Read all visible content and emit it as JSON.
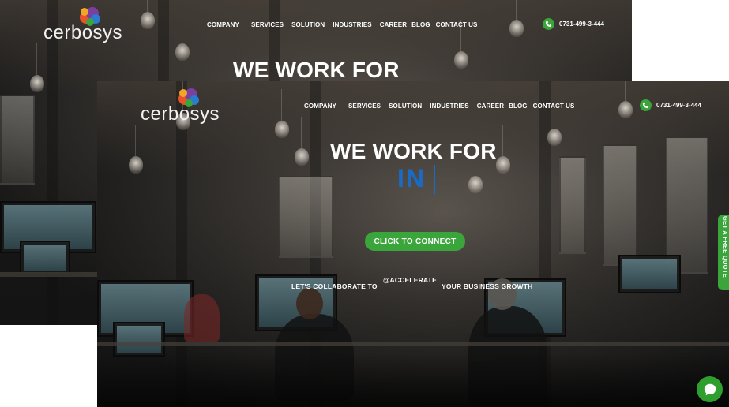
{
  "brand": {
    "name": "cerbosys"
  },
  "nav": {
    "items": [
      "COMPANY",
      "SERVICES",
      "SOLUTION",
      "INDUSTRIES",
      "CAREER",
      "BLOG",
      "CONTACT US"
    ]
  },
  "contact": {
    "phone": "0731-499-3-444"
  },
  "hero": {
    "title": "WE WORK FOR",
    "typed_text": "IN",
    "cta_label": "CLICK TO CONNECT",
    "tagline_left": "LET'S COLLABORATE TO",
    "tagline_mid": "@ACCELERATE",
    "tagline_right": "YOUR BUSINESS GROWTH"
  },
  "side_tab": {
    "label": "GET A FREE QUOTE"
  },
  "icons": {
    "phone": "phone-icon",
    "chat": "chat-icon",
    "logo_mark": "cerbosys-logo-mark"
  },
  "colors": {
    "accent_green": "#3aa53a",
    "typed_blue": "#1a6bc5",
    "text_white": "#ffffff"
  }
}
